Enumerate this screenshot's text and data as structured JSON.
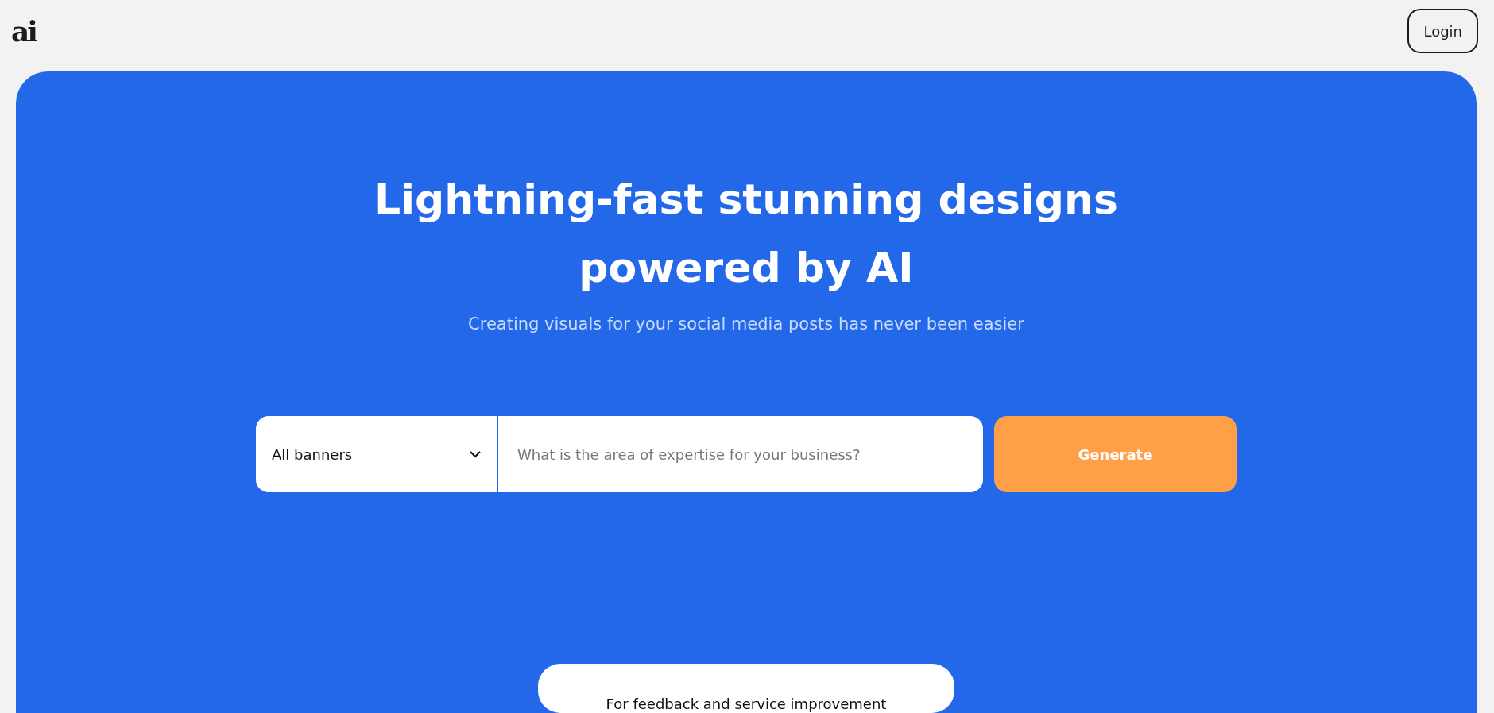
{
  "header": {
    "logo": "ai",
    "login_button": "Login"
  },
  "hero": {
    "title_lines": [
      "Lightning-fast stunning designs",
      "powered by AI"
    ],
    "subtitle": "Creating visuals for your social media posts has never been easier",
    "form": {
      "select": {
        "value": "All banners"
      },
      "input": {
        "placeholder": "What is the area of expertise for your business?"
      },
      "button": "Generate"
    },
    "card": {
      "text": "For feedback and service improvement"
    }
  }
}
